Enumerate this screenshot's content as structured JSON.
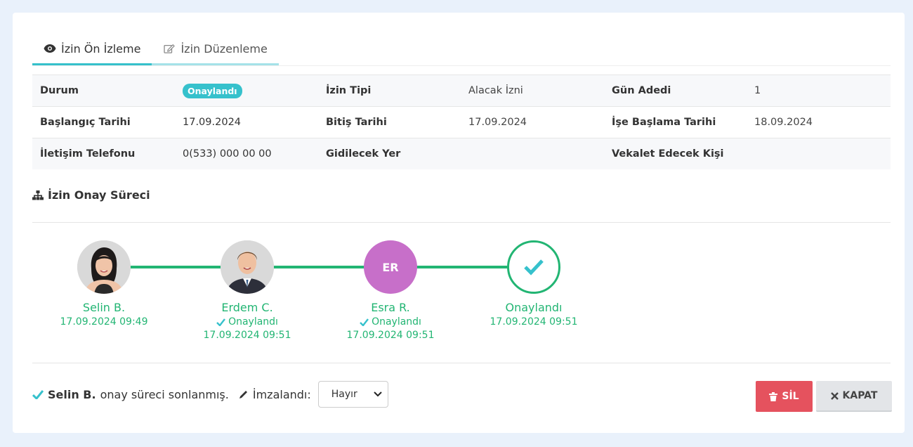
{
  "tabs": [
    {
      "label": "İzin Ön İzleme",
      "icon": "eye-icon",
      "active": true
    },
    {
      "label": "İzin Düzenleme",
      "icon": "edit-icon",
      "active": false
    }
  ],
  "info": {
    "row1": {
      "label1": "Durum",
      "badge": "Onaylandı",
      "label2": "İzin Tipi",
      "value2": "Alacak İzni",
      "label3": "Gün Adedi",
      "value3": "1"
    },
    "row2": {
      "label1": "Başlangıç Tarihi",
      "value1": "17.09.2024",
      "label2": "Bitiş Tarihi",
      "value2": "17.09.2024",
      "label3": "İşe Başlama Tarihi",
      "value3": "18.09.2024"
    },
    "row3": {
      "label1": "İletişim Telefonu",
      "value1": "0(533) 000 00 00",
      "label2": "Gidilecek Yer",
      "value2": "",
      "label3": "Vekalet Edecek Kişi",
      "value3": ""
    }
  },
  "process": {
    "title": "İzin Onay Süreci",
    "steps": [
      {
        "name": "Selin B.",
        "status": "",
        "date": "17.09.2024 09:49"
      },
      {
        "name": "Erdem C.",
        "status": "Onaylandı",
        "date": "17.09.2024 09:51"
      },
      {
        "name": "Esra R.",
        "initials": "ER",
        "status": "Onaylandı",
        "date": "17.09.2024 09:51"
      },
      {
        "name": "Onaylandı",
        "status": "",
        "date": "17.09.2024 09:51"
      }
    ]
  },
  "footer": {
    "user": "Selin B.",
    "message": "onay süreci sonlanmış.",
    "signed_label": "İmzalandı:",
    "signed_value": "Hayır"
  },
  "buttons": {
    "delete": "SİL",
    "close": "KAPAT"
  },
  "colors": {
    "accent": "#35c0cb",
    "success": "#22b573",
    "danger": "#e5525e",
    "avatar_er": "#c76fc9"
  }
}
